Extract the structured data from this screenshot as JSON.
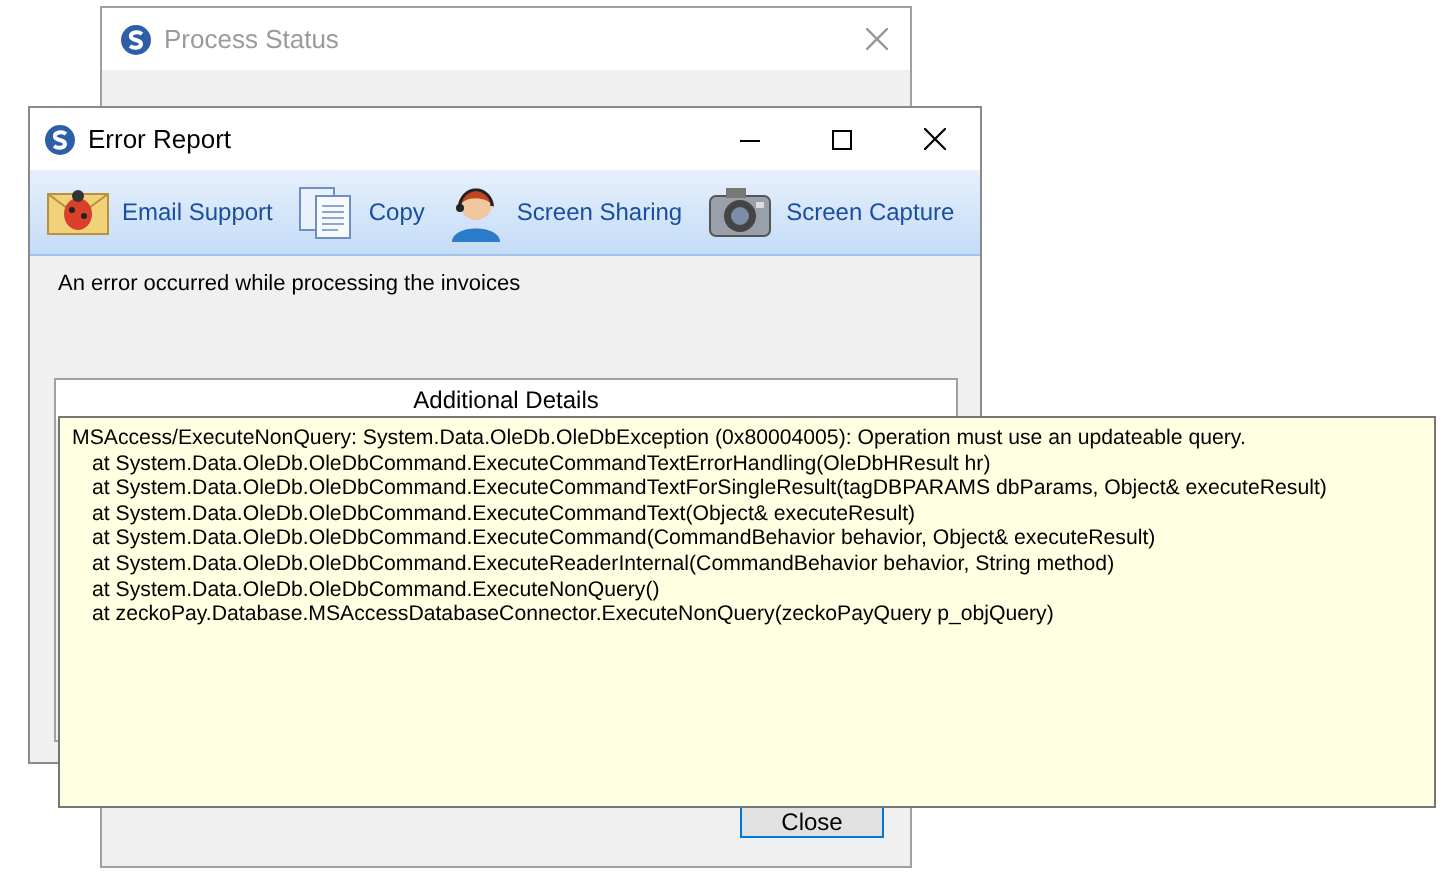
{
  "background_window": {
    "title": "Process Status",
    "close_button": "Close"
  },
  "window": {
    "title": "Error Report"
  },
  "toolbar": [
    {
      "label": "Email Support",
      "kind": "mail"
    },
    {
      "label": "Copy",
      "kind": "copy"
    },
    {
      "label": "Screen Sharing",
      "kind": "support"
    },
    {
      "label": "Screen Capture",
      "kind": "camera"
    }
  ],
  "message": "An error occurred while processing the invoices",
  "details": {
    "header": "Additional Details",
    "lines": [
      "MSAccess/ExecuteNonQuery: System.Data.OleDb.OleDbException (0x80004005): Operation must use an updateable query.",
      "   at System.Data.OleDb.OleDbCommand.ExecuteCommandTextErrorHandling(OleDbHResult hr)",
      "   at System.Data.OleDb.OleDbCommand.ExecuteCommandTextForSingleResult(tagDBPARAMS dbParams, Object& executeResult)",
      "   at System.Data.OleDb.OleDbCommand.ExecuteCommandText(Object& executeResult)",
      "   at System.Data.OleDb.OleDbCommand.ExecuteCommand(CommandBehavior behavior, Object& executeResult)",
      "   at System.Data.OleDb.OleDbCommand.ExecuteReaderInternal(CommandBehavior behavior, String method)",
      "   at System.Data.OleDb.OleDbCommand.ExecuteNonQuery()",
      "   at zeckoPay.Database.MSAccessDatabaseConnector.ExecuteNonQuery(zeckoPayQuery p_objQuery)"
    ]
  }
}
